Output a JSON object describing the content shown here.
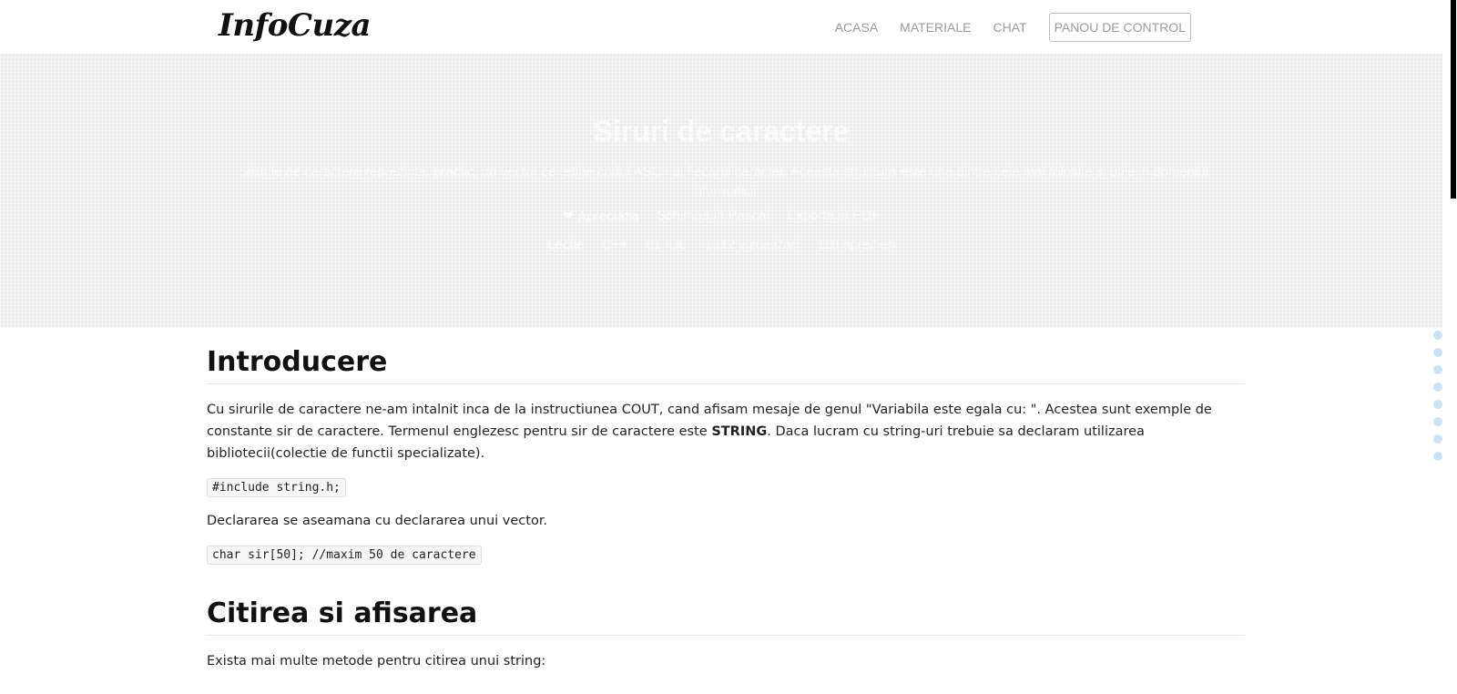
{
  "brand": "InfoCuza",
  "nav": {
    "acasa": "ACASA",
    "materiale": "MATERIALE",
    "chat": "CHAT",
    "panou": "PANOU DE CONTROL"
  },
  "hero": {
    "title": "Siruri de caractere",
    "description": "Sirurile de caractere reprezinta, practic, un vector ce retine codul ASCII al fiecarui caracter. Aceasta structura este una dintre cele mai folosite si utile in domeniul informaticii",
    "actions": {
      "apreciaza": "Apreciaza",
      "schimba": "Schimba in Pascal",
      "exporta": "Exporta in PDF"
    },
    "meta": {
      "tip": "Lectie",
      "limbaj": "C++",
      "data": "01 IUL",
      "vizualizari": "1312 vizualizari",
      "aprecieri": "110 aprecieri"
    }
  },
  "content": {
    "intro": {
      "heading": "Introducere",
      "p1_a": "Cu sirurile de caractere ne-am intalnit inca de la instructiunea COUT, cand afisam mesaje de genul \"Variabila este egala cu: \". Acestea sunt exemple de constante sir de caractere. Termenul englezesc pentru sir de caractere este ",
      "p1_strong": "STRING",
      "p1_b": ". Daca lucram cu string-uri trebuie sa declaram utilizarea bibliotecii(colectie de functii specializate).",
      "code1": "#include string.h;",
      "p2": "Declararea se aseamana cu declararea unui vector.",
      "code2": "char sir[50]; //maxim 50 de caractere"
    },
    "citire": {
      "heading": "Citirea si afisarea",
      "p1": "Exista mai multe metode pentru citirea unui string:"
    }
  },
  "colors": {
    "hero_bg": "#ececec",
    "dot": "#c9e3f5",
    "nav_text": "#9a9a9a"
  }
}
